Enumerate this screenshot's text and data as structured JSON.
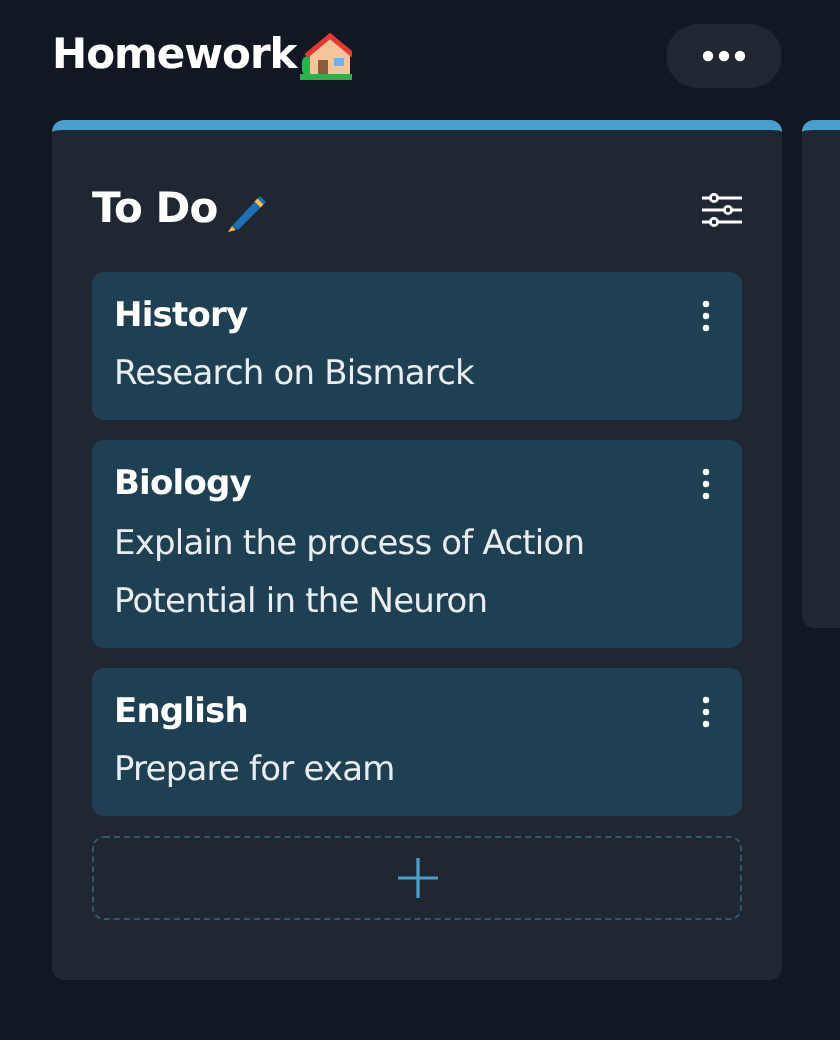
{
  "board": {
    "title": "Homework"
  },
  "column": {
    "title": "To Do",
    "cards": [
      {
        "subject": "History",
        "task": "Research on Bismarck"
      },
      {
        "subject": "Biology",
        "task": "Explain the process of Action Potential in the Neuron"
      },
      {
        "subject": "English",
        "task": "Prepare for exam"
      }
    ]
  }
}
